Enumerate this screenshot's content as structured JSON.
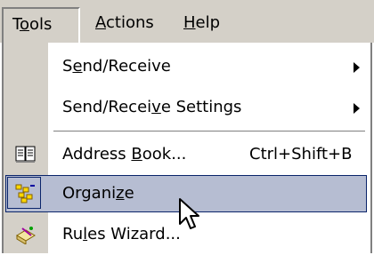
{
  "menubar": {
    "tools": {
      "pre": "T",
      "u": "o",
      "post": "ols"
    },
    "actions": {
      "pre": "",
      "u": "A",
      "post": "ctions"
    },
    "help": {
      "pre": "",
      "u": "H",
      "post": "elp"
    }
  },
  "menu": {
    "items": [
      {
        "pre": "S",
        "u": "e",
        "post": "nd/Receive",
        "submenu": true,
        "icon": null
      },
      {
        "pre": "Send/Recei",
        "u": "v",
        "post": "e Settings",
        "submenu": true,
        "icon": null
      },
      {
        "pre": "Address ",
        "u": "B",
        "post": "ook...",
        "shortcut": "Ctrl+Shift+B",
        "icon": "address-book-icon"
      },
      {
        "pre": "Organi",
        "u": "z",
        "post": "e",
        "highlighted": true,
        "icon": "organize-icon"
      },
      {
        "pre": "Ru",
        "u": "l",
        "post": "es Wizard...",
        "icon": "rules-wizard-icon"
      }
    ]
  },
  "colors": {
    "menu_bar": "#d4d0c8",
    "highlight": "#b6bdd2",
    "highlight_border": "#0a246a"
  }
}
